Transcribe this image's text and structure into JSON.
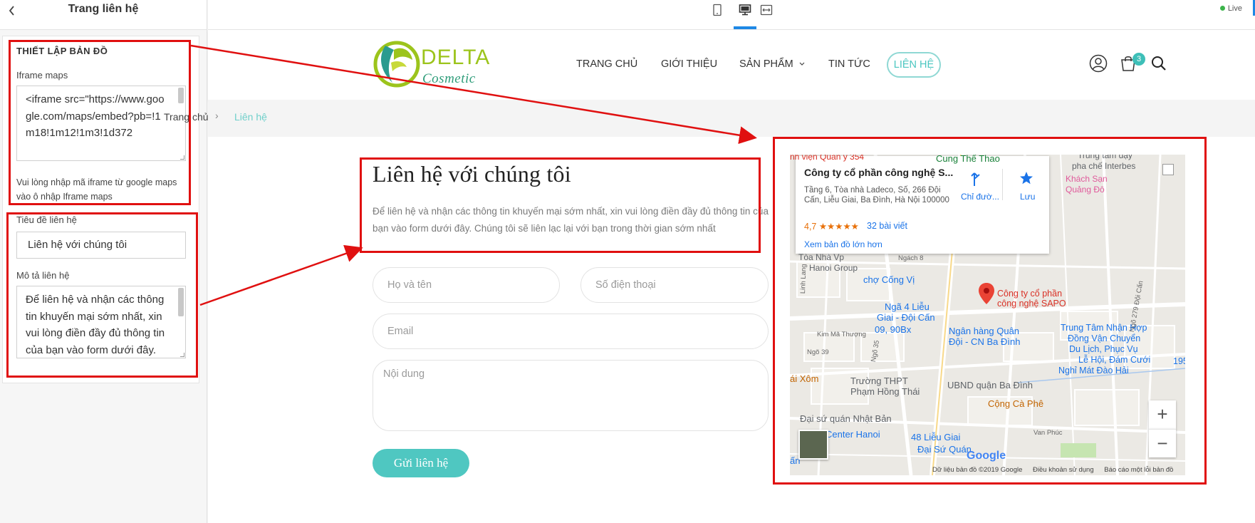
{
  "left_panel": {
    "back_icon": "chevron-left-icon",
    "title": "Trang liên hệ",
    "map_section_title": "THIẾT LẬP BẢN ĐỒ",
    "iframe_label": "Iframe maps",
    "iframe_value": "<iframe src=\"https://www.google.com/maps/embed?pb=!1m18!1m12!1m3!1d372",
    "iframe_hint": "Vui lòng nhập mã iframe từ google maps vào ô nhập Iframe maps",
    "contact_title_label": "Tiêu đề liên hệ",
    "contact_title_value": "Liên hệ với chúng tôi",
    "contact_desc_label": "Mô tả liên hệ",
    "contact_desc_value": "Để liên hệ và nhận các thông tin khuyến mại sớm nhất, xin vui lòng điền đầy đủ thông tin của bạn vào form dưới đây."
  },
  "toolbar": {
    "devices": [
      "mobile-icon",
      "desktop-icon",
      "fullwidth-icon"
    ],
    "active_device": "desktop-icon",
    "live_label": "Live",
    "live_color": "#3cb44b",
    "accent_color": "#1e88e5"
  },
  "site": {
    "logo_delta": "DELTA",
    "logo_cosmetic": "Cosmetic",
    "nav": [
      "TRANG CHỦ",
      "GIỚI THIỆU",
      "SẢN PHẨM",
      "TIN TỨC",
      "LIÊN HỆ"
    ],
    "cart_count": "3",
    "breadcrumb": {
      "home": "Trang chủ",
      "separator": "›",
      "current": "Liên hệ"
    },
    "contact_title": "Liên hệ với chúng tôi",
    "contact_desc": "Để liên hệ và nhận các thông tin khuyến mại sớm nhất, xin vui lòng điền đầy đủ thông tin của bạn vào form dưới đây. Chúng tôi sẽ liên lạc lại với bạn trong thời gian sớm nhất",
    "form": {
      "name_placeholder": "Họ và tên",
      "phone_placeholder": "Số điện thoại",
      "email_placeholder": "Email",
      "content_placeholder": "Nội dung",
      "submit": "Gửi liên hệ"
    },
    "brand_color": "#4fc7c1"
  },
  "map": {
    "card": {
      "name": "Công ty cổ phần công nghệ S...",
      "address": "Tầng 6, Tòa nhà Ladeco, Số, 266 Đội Cấn, Liễu Giai, Ba Đình, Hà Nội 100000",
      "rating": "4,7 ★★★★★",
      "reviews": "32 bài viết",
      "directions": "Chỉ đườ...",
      "save": "Lưu",
      "view_larger": "Xem bản đồ lớn hơn"
    },
    "labels": {
      "hospital": "nh viện Quân y 354",
      "sport": "Cung Thể Thao",
      "trungtam": "Trung tâm dạy",
      "phachuyen": "pha chế Interbes",
      "hotel1": "Khách Sạn",
      "hotel2": "Quảng Đô",
      "toanha": "Tòa Nhà Vp",
      "hanoigroup": "Hanoi Group",
      "ngach8": "Ngách 8",
      "cho": "chợ Cống Vị",
      "sapo1": "Công ty cổ phần",
      "sapo2": "công nghệ SAPO",
      "nga4a": "Ngã 4 Liễu",
      "nga4b": "Giai - Đội Cấn",
      "bx": "09, 90Bx",
      "bank1": "Ngân hàng Quân",
      "bank2": "Đội - CN Ba Đình",
      "tt1": "Trung Tâm Nhận Hợp",
      "tt2": "Đồng Vận Chuyển",
      "tt3": "Du Lịch, Phục Vụ",
      "tt4": "Lễ Hội, Đám Cưới",
      "tt5": "Nghỉ Mát Đào Hải",
      "n195": "195",
      "kimma": "Kim Mã Thượng",
      "ngo39": "Ngõ 39",
      "ngo35": "Ngõ 35",
      "ngo279": "Ngõ 279 Đội Cấn",
      "linhlang": "Linh Lang",
      "aixom": "ái Xôm",
      "thpt1": "Trường THPT",
      "thpt2": "Phạm Hồng Thái",
      "ubnd": "UBND quận Ba Đình",
      "caphe": "Cộng Cà Phê",
      "dsq1": "Đại sứ quán Nhật Bản",
      "center": "Center Hanoi",
      "lieugiai48": "48 Liễu Giai",
      "dsq2": "Đại Sứ Quán",
      "van": "ấn",
      "vanphuc": "Van Phúc",
      "google": "Google",
      "data": "Dữ liệu bản đồ ©2019 Google",
      "terms": "Điều khoản sử dụng",
      "report": "Báo cáo một lỗi bản đồ"
    }
  },
  "annotation_color": "#e01010"
}
